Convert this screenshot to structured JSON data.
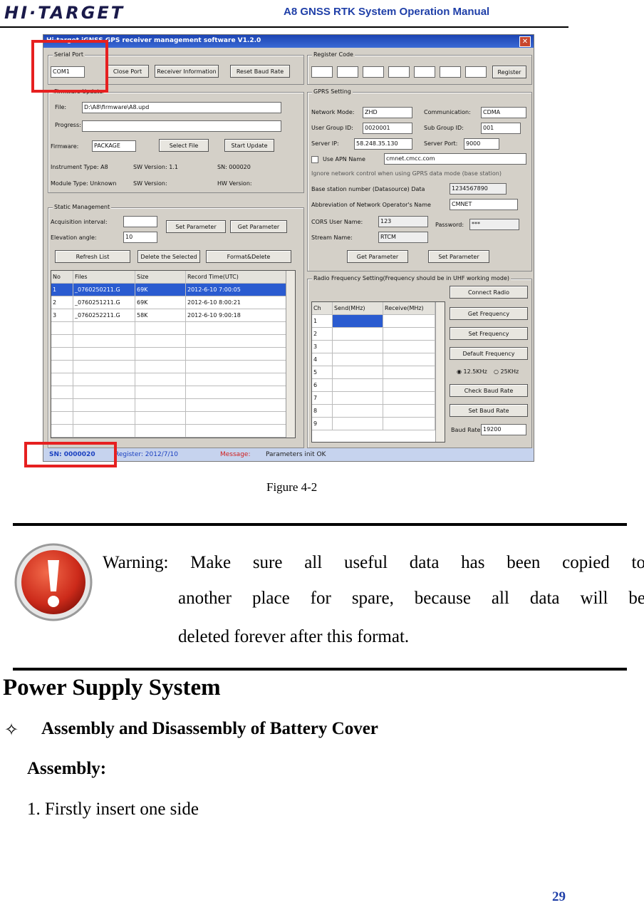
{
  "header": {
    "logo": "HI·TARGET",
    "title": "A8  GNSS RTK System Operation Manual"
  },
  "screenshot": {
    "window_title": "Hi-target iGNSS GPS receiver management software V1.2.0",
    "serial_port_label": "Serial Port",
    "serial_port_value": "COM1",
    "close_port": "Close Port",
    "receiver_information": "Receiver Information",
    "reset_baud_rate": "Reset Baud Rate",
    "firmware_group": "Firmware Update",
    "file_label": "File:",
    "file_value": "D:\\A8\\firmware\\A8.upd",
    "progress_label": "Progress:",
    "format_label": "Firmware:",
    "format_value": "PACKAGE",
    "select_file": "Select File",
    "start_update": "Start Update",
    "instrument_type": "Instrument Type: A8",
    "sw_version": "SW Version: 1.1",
    "sn": "SN: 000020",
    "module_type": "Module Type: Unknown",
    "sw_version2": "SW Version:",
    "hw_version": "HW Version:",
    "static_group": "Static Management",
    "acq_interval": "Acquisition interval:",
    "elev_angle": "Elevation angle:",
    "elev_value": "10",
    "set_parameter_btn": "Set Parameter",
    "get_parameter_btn": "Get Parameter",
    "refresh_list": "Refresh List",
    "delete_selected": "Delete the Selected",
    "format_delete": "Format&Delete",
    "file_table": {
      "headers": [
        "No",
        "Files",
        "Size",
        "Record Time(UTC)"
      ],
      "rows": [
        [
          "1",
          "_0760250211.G",
          "69K",
          "2012-6-10 7:00:05"
        ],
        [
          "2",
          "_0760251211.G",
          "69K",
          "2012-6-10 8:00:21"
        ],
        [
          "3",
          "_0760252211.G",
          "58K",
          "2012-6-10 9:00:18"
        ]
      ]
    },
    "register_group": "Register Code",
    "register_btn": "Register",
    "gprs_group": "GPRS Setting",
    "network_mode_label": "Network Mode:",
    "network_mode_value": "ZHD",
    "communication_label": "Communication:",
    "communication_value": "CDMA",
    "user_group_id_label": "User Group ID:",
    "user_group_id_value": "0020001",
    "sub_group_id_label": "Sub Group ID:",
    "sub_group_id_value": "001",
    "server_ip_label": "Server IP:",
    "server_ip_value": "58.248.35.130",
    "server_port_label": "Server Port:",
    "server_port_value": "9000",
    "use_apn_label": "Use APN Name",
    "apn_value": "cmnet.cmcc.com",
    "ignore_label": "Ignore network control when using GPRS data mode (base station)",
    "base_station_label": "Base station number (Datasource) Data",
    "base_station_value": "1234567890",
    "abbrev_label": "Abbreviation of Network Operator's Name",
    "abbrev_value": "CMNET",
    "cors_user_label": "CORS User Name:",
    "cors_user_value": "123",
    "password_label": "Password:",
    "password_value": "***",
    "stream_label": "Stream Name:",
    "stream_value": "RTCM",
    "get_parameter2": "Get Parameter",
    "set_parameter2": "Set Parameter",
    "radio_group": "Radio Frequency Setting(Frequency should be in UHF working mode)",
    "radio_table_headers": [
      "Ch",
      "Send(MHz)",
      "Receive(MHz)"
    ],
    "radio_rows": [
      "1",
      "2",
      "3",
      "4",
      "5",
      "6",
      "7",
      "8",
      "9"
    ],
    "connect_radio": "Connect Radio",
    "get_frequency": "Get Frequency",
    "set_frequency": "Set Frequency",
    "default_frequency": "Default Frequency",
    "khz_opt1": "12.5KHz",
    "khz_opt2": "25KHz",
    "check_baud": "Check Baud Rate",
    "set_baud": "Set Baud Rate",
    "baud_label": "Baud Rate:",
    "baud_value": "19200",
    "status_sn": "SN: 0000020",
    "status_register": "Register: 2012/7/10",
    "status_message_label": "Message:",
    "status_message": "Parameters init OK"
  },
  "body": {
    "caption": "Figure 4-2",
    "warning_line1": "Warning: Make sure all useful data has been copied to",
    "warning_line2": "another place for spare, because all data will be",
    "warning_line3": "deleted forever after this format.",
    "heading": "Power Supply System",
    "subheading_icon": "✧",
    "subheading": "Assembly and Disassembly of Battery Cover",
    "subsubheading": "Assembly:",
    "step1": "1. Firstly insert one side",
    "page_number": "29"
  },
  "colors": {
    "header_blue": "#1f3fa8",
    "highlight_red": "#e62020",
    "warning_red": "#cc2a1a"
  }
}
